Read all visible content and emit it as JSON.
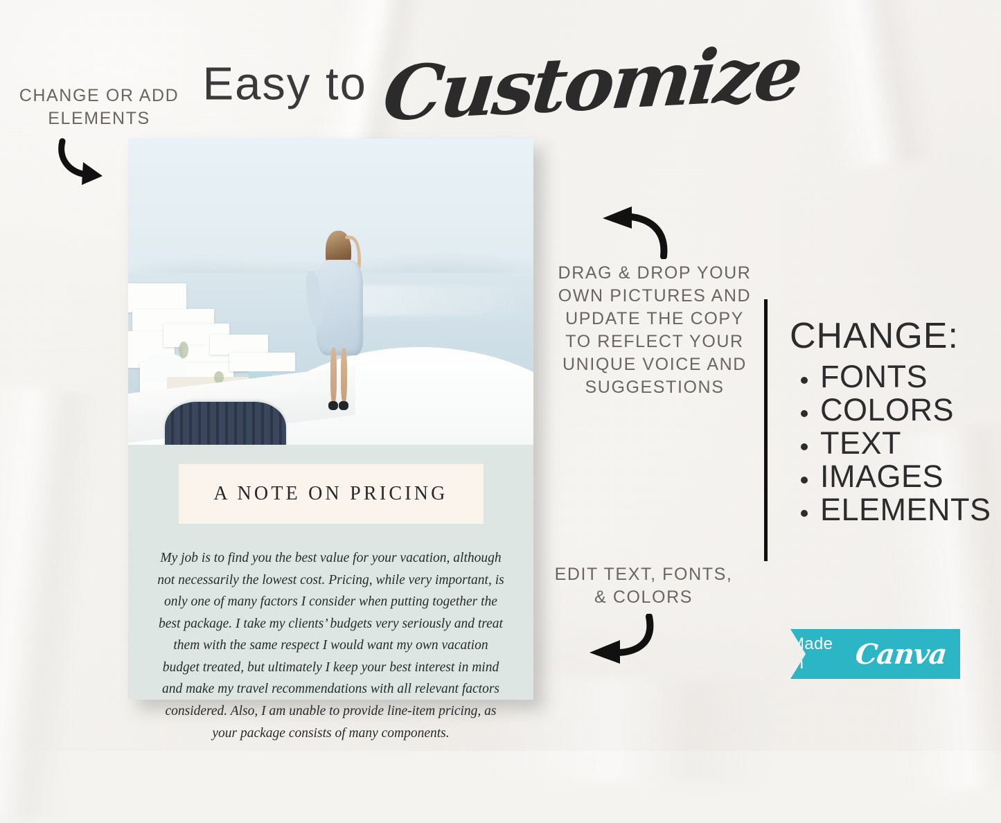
{
  "headline": {
    "plain": "Easy to",
    "script": "Customize"
  },
  "annotations": {
    "change_elements": "CHANGE OR ADD ELEMENTS",
    "drag_drop": "DRAG & DROP YOUR OWN PICTURES AND UPDATE THE COPY TO REFLECT YOUR UNIQUE VOICE AND SUGGESTIONS",
    "edit_text": "EDIT TEXT, FONTS, & COLORS"
  },
  "change_panel": {
    "title": "CHANGE:",
    "items": [
      "FONTS",
      "COLORS",
      "TEXT",
      "IMAGES",
      "ELEMENTS"
    ]
  },
  "card": {
    "title": "A NOTE ON PRICING",
    "body": "My job is to find you the best value for your vacation, although not necessarily the lowest cost. Pricing, while very important, is only one of many factors I consider when putting together the best package. I take my clients’ budgets very seriously and treat them with the same respect I would want my own vacation budget treated, but ultimately I keep your best interest in mind and make my travel recommendations with all relevant factors considered. Also, I am unable to provide line-item pricing, as your package consists of many components.",
    "photo_alt": "Woman standing on a white domed rooftop overlooking the sea in Santorini"
  },
  "badge": {
    "made_in": "Made in",
    "brand": "Canva"
  },
  "colors": {
    "background": "#f5f3f0",
    "card_body": "#dde6e2",
    "card_title_band": "#faf4ed",
    "heading_text": "#2b2b2b",
    "caption_text": "#6b6560",
    "divider": "#111111",
    "canva_teal": "#2cb5c4"
  }
}
